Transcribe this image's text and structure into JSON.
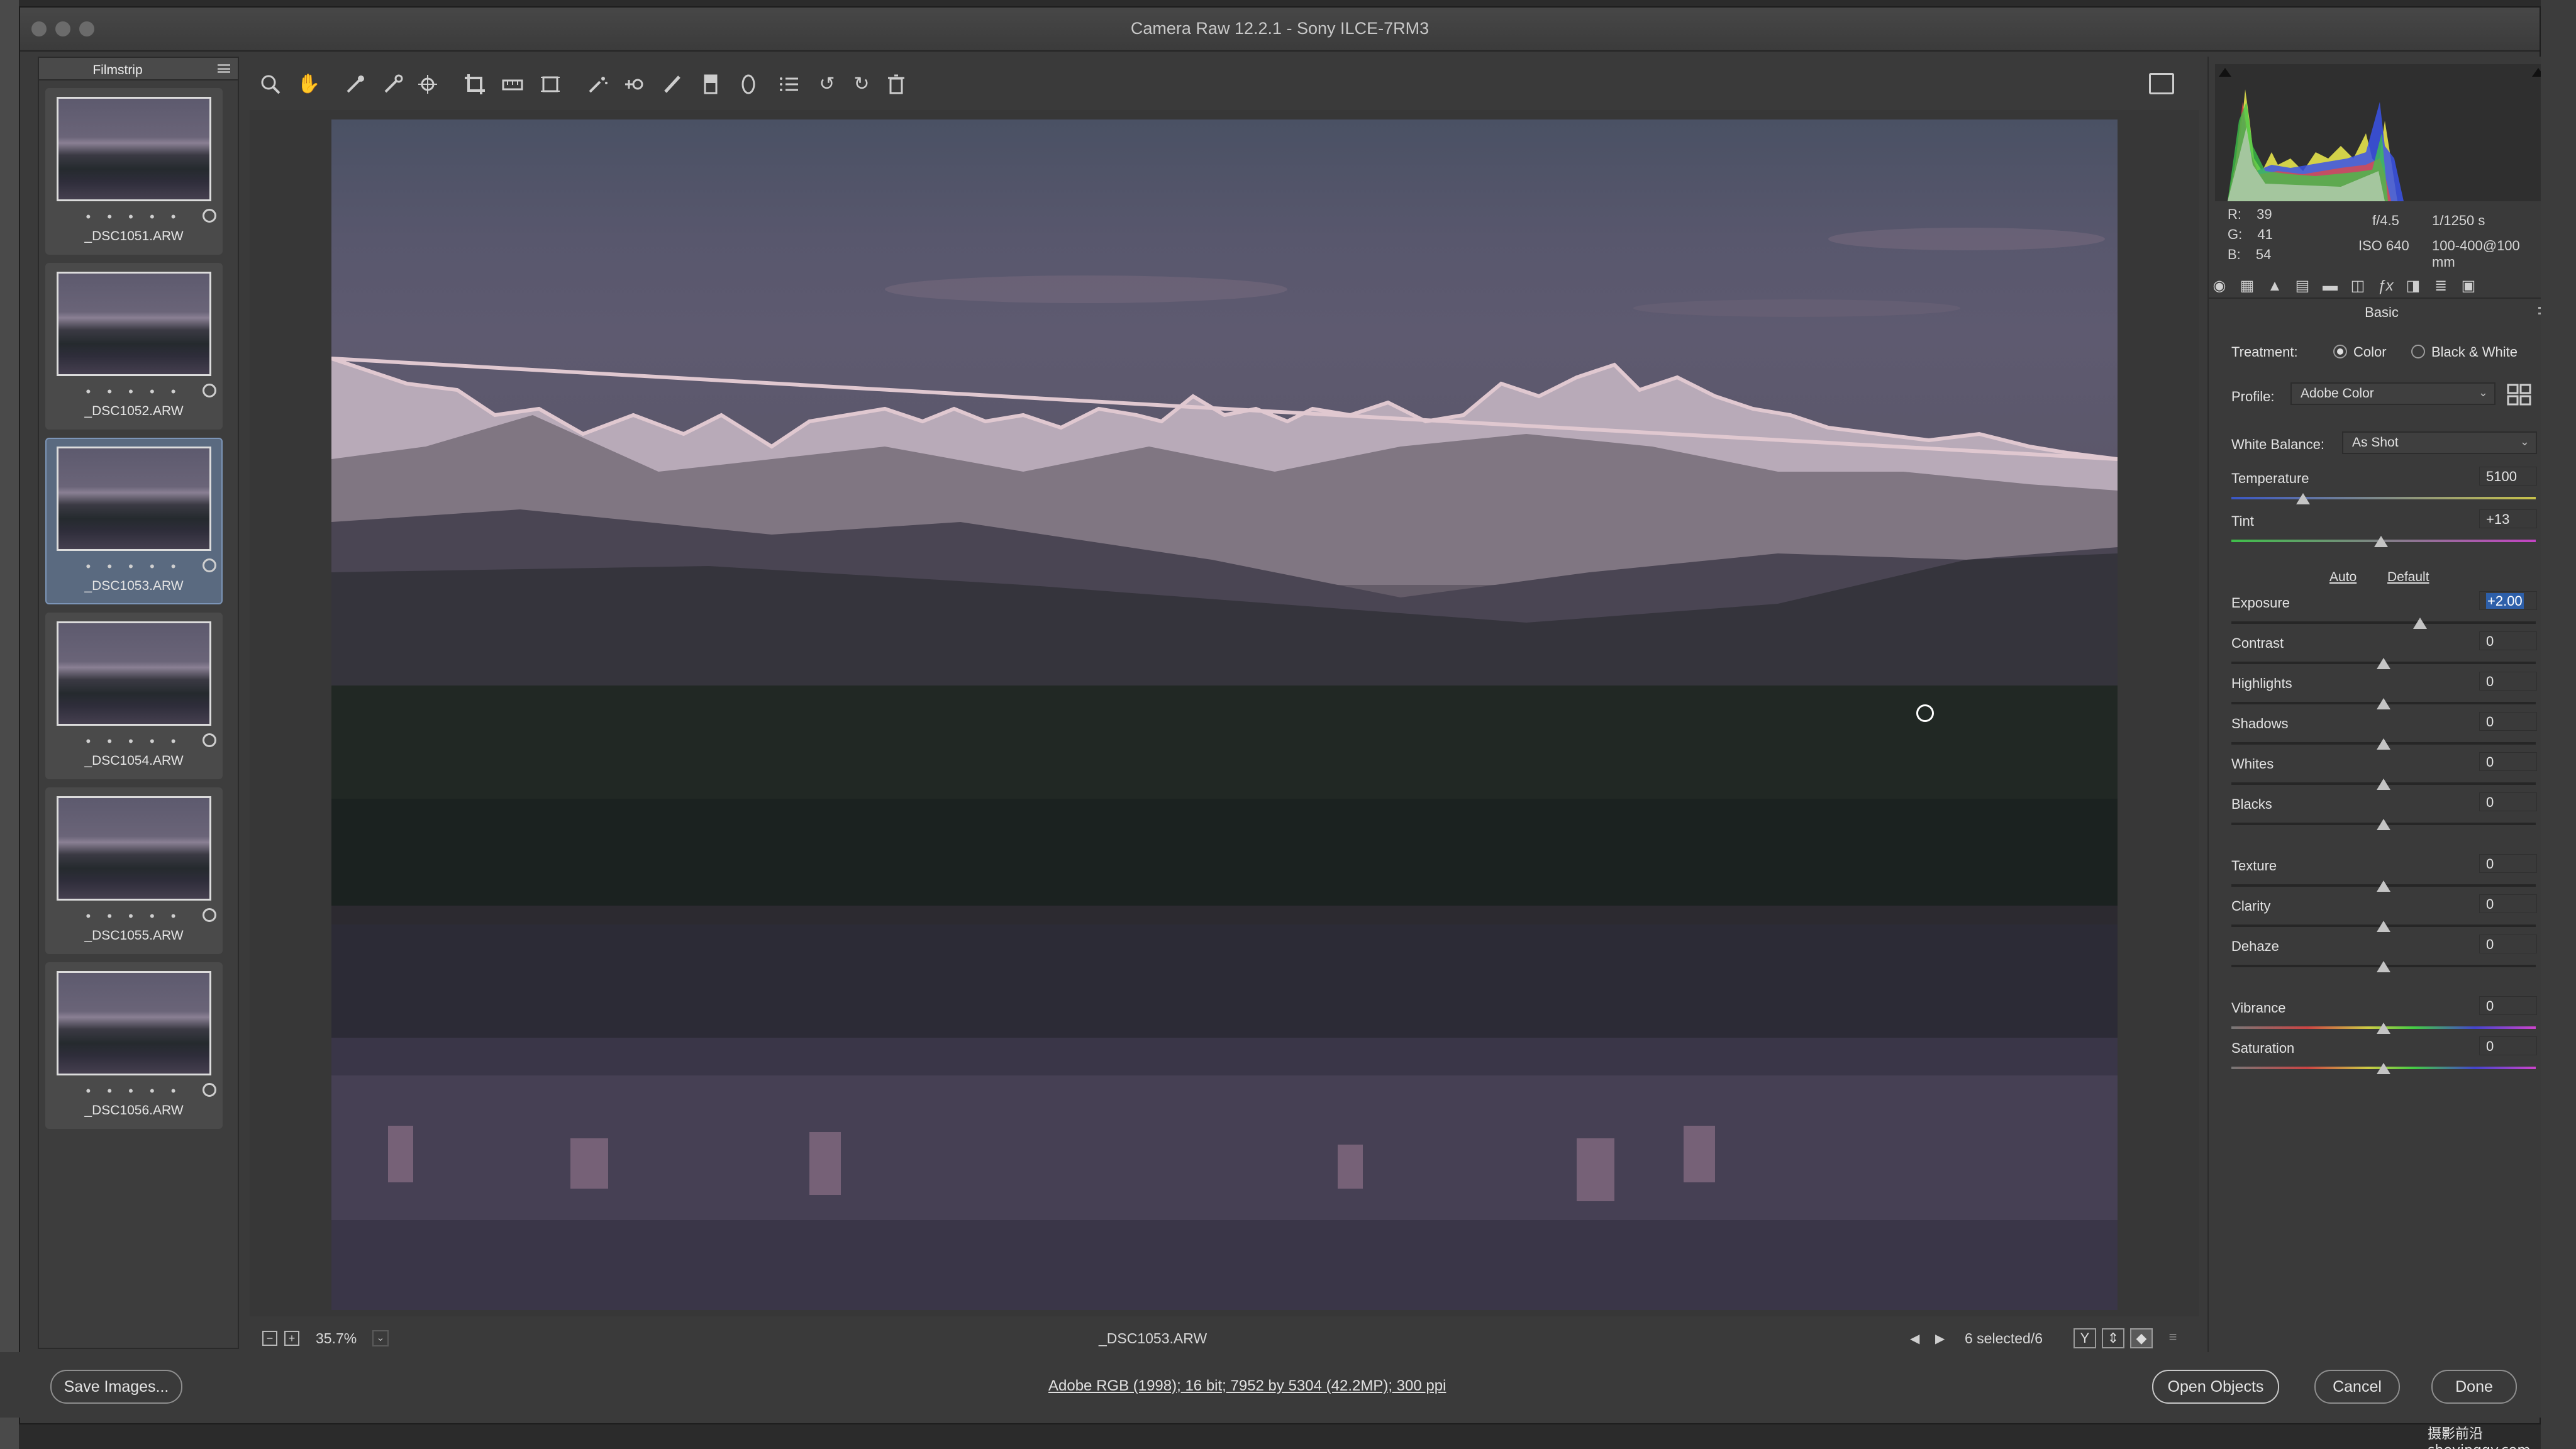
{
  "window": {
    "title": "Camera Raw 12.2.1  -  Sony ILCE-7RM3"
  },
  "filmstrip": {
    "title": "Filmstrip",
    "items": [
      {
        "label": "_DSC1051.ARW",
        "rating_dots": "• • • • •",
        "selected": false
      },
      {
        "label": "_DSC1052.ARW",
        "rating_dots": "• • • • •",
        "selected": false
      },
      {
        "label": "_DSC1053.ARW",
        "rating_dots": "• • • • •",
        "selected": true
      },
      {
        "label": "_DSC1054.ARW",
        "rating_dots": "• • • • •",
        "selected": false
      },
      {
        "label": "_DSC1055.ARW",
        "rating_dots": "• • • • •",
        "selected": false
      },
      {
        "label": "_DSC1056.ARW",
        "rating_dots": "• • • • •",
        "selected": false
      }
    ]
  },
  "toolbar": {
    "tools": [
      "zoom-tool-icon",
      "hand-tool-icon",
      "white-balance-tool-icon",
      "color-sampler-icon",
      "targeted-adjustment-icon",
      "crop-tool-icon",
      "straighten-tool-icon",
      "transform-tool-icon",
      "spot-removal-icon",
      "red-eye-icon",
      "adjustment-brush-icon",
      "graduated-filter-icon",
      "radial-filter-icon",
      "preferences-list-icon",
      "rotate-ccw-icon",
      "rotate-cw-icon",
      "trash-icon"
    ]
  },
  "statusbar": {
    "zoom": "35.7%",
    "filename": "_DSC1053.ARW",
    "selected": "6 selected/6",
    "view_btn_y": "Y"
  },
  "right": {
    "readout": {
      "r_label": "R:",
      "r": "39",
      "g_label": "G:",
      "g": "41",
      "b_label": "B:",
      "b": "54",
      "aperture": "f/4.5",
      "shutter": "1/1250 s",
      "iso": "ISO 640",
      "lens": "100-400@100 mm"
    },
    "section": "Basic",
    "treatment_label": "Treatment:",
    "treatment_options": [
      "Color",
      "Black & White"
    ],
    "treatment_selected": "Color",
    "profile_label": "Profile:",
    "profile_value": "Adobe Color",
    "wb_label": "White Balance:",
    "wb_value": "As Shot",
    "auto": "Auto",
    "default": "Default",
    "sliders": [
      {
        "label": "Temperature",
        "value": "5100"
      },
      {
        "label": "Tint",
        "value": "+13"
      },
      {
        "label": "Exposure",
        "value": "+2.00"
      },
      {
        "label": "Contrast",
        "value": "0"
      },
      {
        "label": "Highlights",
        "value": "0"
      },
      {
        "label": "Shadows",
        "value": "0"
      },
      {
        "label": "Whites",
        "value": "0"
      },
      {
        "label": "Blacks",
        "value": "0"
      },
      {
        "label": "Texture",
        "value": "0"
      },
      {
        "label": "Clarity",
        "value": "0"
      },
      {
        "label": "Dehaze",
        "value": "0"
      },
      {
        "label": "Vibrance",
        "value": "0"
      },
      {
        "label": "Saturation",
        "value": "0"
      }
    ]
  },
  "bottom": {
    "save": "Save Images...",
    "workflow": "Adobe RGB (1998); 16 bit; 7952 by 5304 (42.2MP); 300 ppi",
    "open": "Open Objects",
    "cancel": "Cancel",
    "done": "Done"
  },
  "watermark": "摄影前沿 sheyingqy.com",
  "colors": {
    "accent": "#2d5fa9",
    "panel": "#3a3a3a",
    "selected_thumb": "#5a6a80"
  }
}
